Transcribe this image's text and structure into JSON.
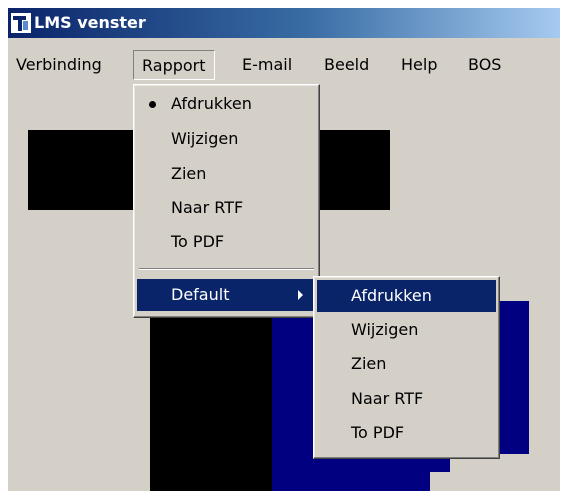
{
  "window": {
    "title": "LMS venster",
    "icon": "app-logo-icon"
  },
  "menubar": {
    "items": [
      {
        "label": "Verbinding"
      },
      {
        "label": "Rapport",
        "open": true
      },
      {
        "label": "E-mail"
      },
      {
        "label": "Beeld"
      },
      {
        "label": "Help"
      },
      {
        "label": "BOS"
      }
    ]
  },
  "rapport_menu": {
    "items": [
      {
        "label": "Afdrukken",
        "checked": true
      },
      {
        "label": "Wijzigen"
      },
      {
        "label": "Zien"
      },
      {
        "label": "Naar RTF"
      },
      {
        "label": "To PDF"
      }
    ],
    "submenu_label": "Default"
  },
  "default_submenu": {
    "items": [
      {
        "label": "Afdrukken",
        "highlighted": true
      },
      {
        "label": "Wijzigen"
      },
      {
        "label": "Zien"
      },
      {
        "label": "Naar RTF"
      },
      {
        "label": "To PDF"
      }
    ]
  },
  "colors": {
    "titlebar_start": "#0a246a",
    "titlebar_end": "#a6caf0",
    "highlight": "#0a246a",
    "face": "#d4d0c8",
    "blue_block": "#000080",
    "black_block": "#000000"
  }
}
